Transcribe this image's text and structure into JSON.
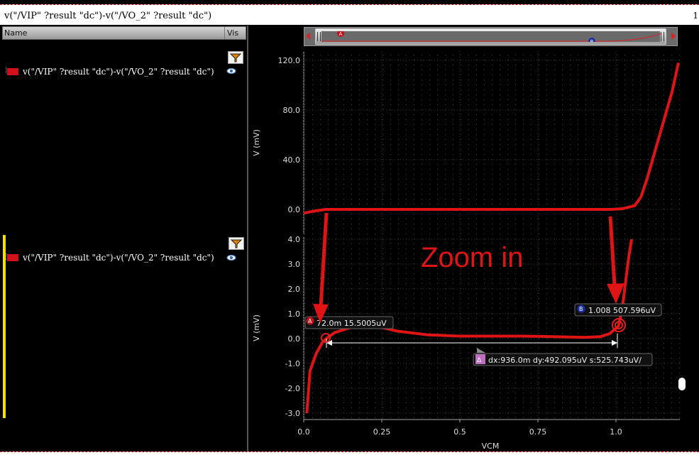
{
  "window": {
    "title": "v(\"/VIP\" ?result \"dc\")-v(\"/VO_2\" ?result \"dc\")",
    "right_marker": "1"
  },
  "trace_panel": {
    "columns": {
      "name": "Name",
      "vis": "Vis"
    },
    "strip1_trace": "v(\"/VIP\" ?result \"dc\")-v(\"/VO_2\" ?result \"dc\")",
    "strip2_trace": "v(\"/VIP\" ?result \"dc\")-v(\"/VO_2\" ?result \"dc\")",
    "trace_color": "#d0101a"
  },
  "scrollbar": {
    "marker_a": "A",
    "marker_b": "B"
  },
  "plot": {
    "top_ylabel": "V (mV)",
    "bottom_ylabel": "V (mV)",
    "xlabel": "VCM",
    "overlay_text": "Zoom in",
    "marker_a": {
      "letter": "A",
      "label": "72.0m 15.5005uV"
    },
    "marker_b": {
      "letter": "B",
      "label": "1.008 507.596uV"
    },
    "delta": {
      "symbol": "Δ",
      "label": "dx:936.0m dy:492.095uV s:525.743uV/"
    }
  },
  "chart_data": [
    {
      "type": "line",
      "title": "",
      "xlabel": "",
      "ylabel": "V (mV)",
      "xlim": [
        0,
        1.2
      ],
      "ylim": [
        -5,
        125
      ],
      "y_ticks": [
        "0.0",
        "40.0",
        "80.0",
        "120.0"
      ],
      "series": [
        {
          "x": [
            0.0,
            0.03,
            0.07,
            0.2,
            0.4,
            0.6,
            0.8,
            0.98,
            1.02,
            1.06,
            1.08,
            1.1,
            1.14,
            1.18,
            1.2
          ],
          "y": [
            -3,
            -1.5,
            0,
            0,
            0,
            0,
            0,
            0,
            0.5,
            3,
            10,
            25,
            60,
            95,
            118
          ]
        }
      ]
    },
    {
      "type": "line",
      "title": "",
      "xlabel": "VCM",
      "ylabel": "V (mV)",
      "xlim": [
        0,
        1.2
      ],
      "ylim": [
        -3.1,
        4.1
      ],
      "x_ticks": [
        "0.0",
        "0.25",
        "0.5",
        "0.75",
        "1.0"
      ],
      "y_ticks": [
        "-3.0",
        "-2.0",
        "-1.0",
        "0.0",
        "1.0",
        "2.0",
        "3.0",
        "4.0"
      ],
      "series": [
        {
          "x": [
            0.01,
            0.02,
            0.04,
            0.06,
            0.072,
            0.1,
            0.15,
            0.2,
            0.25,
            0.3,
            0.4,
            0.5,
            0.6,
            0.7,
            0.8,
            0.9,
            0.95,
            0.98,
            1.008,
            1.02,
            1.03,
            1.04,
            1.05
          ],
          "y": [
            -3.0,
            -1.3,
            -0.6,
            -0.15,
            0.0,
            0.25,
            0.45,
            0.5,
            0.45,
            0.3,
            0.15,
            0.1,
            0.1,
            0.1,
            0.08,
            0.05,
            0.08,
            0.2,
            0.5,
            1.2,
            2.2,
            3.2,
            4.0
          ]
        }
      ]
    }
  ]
}
